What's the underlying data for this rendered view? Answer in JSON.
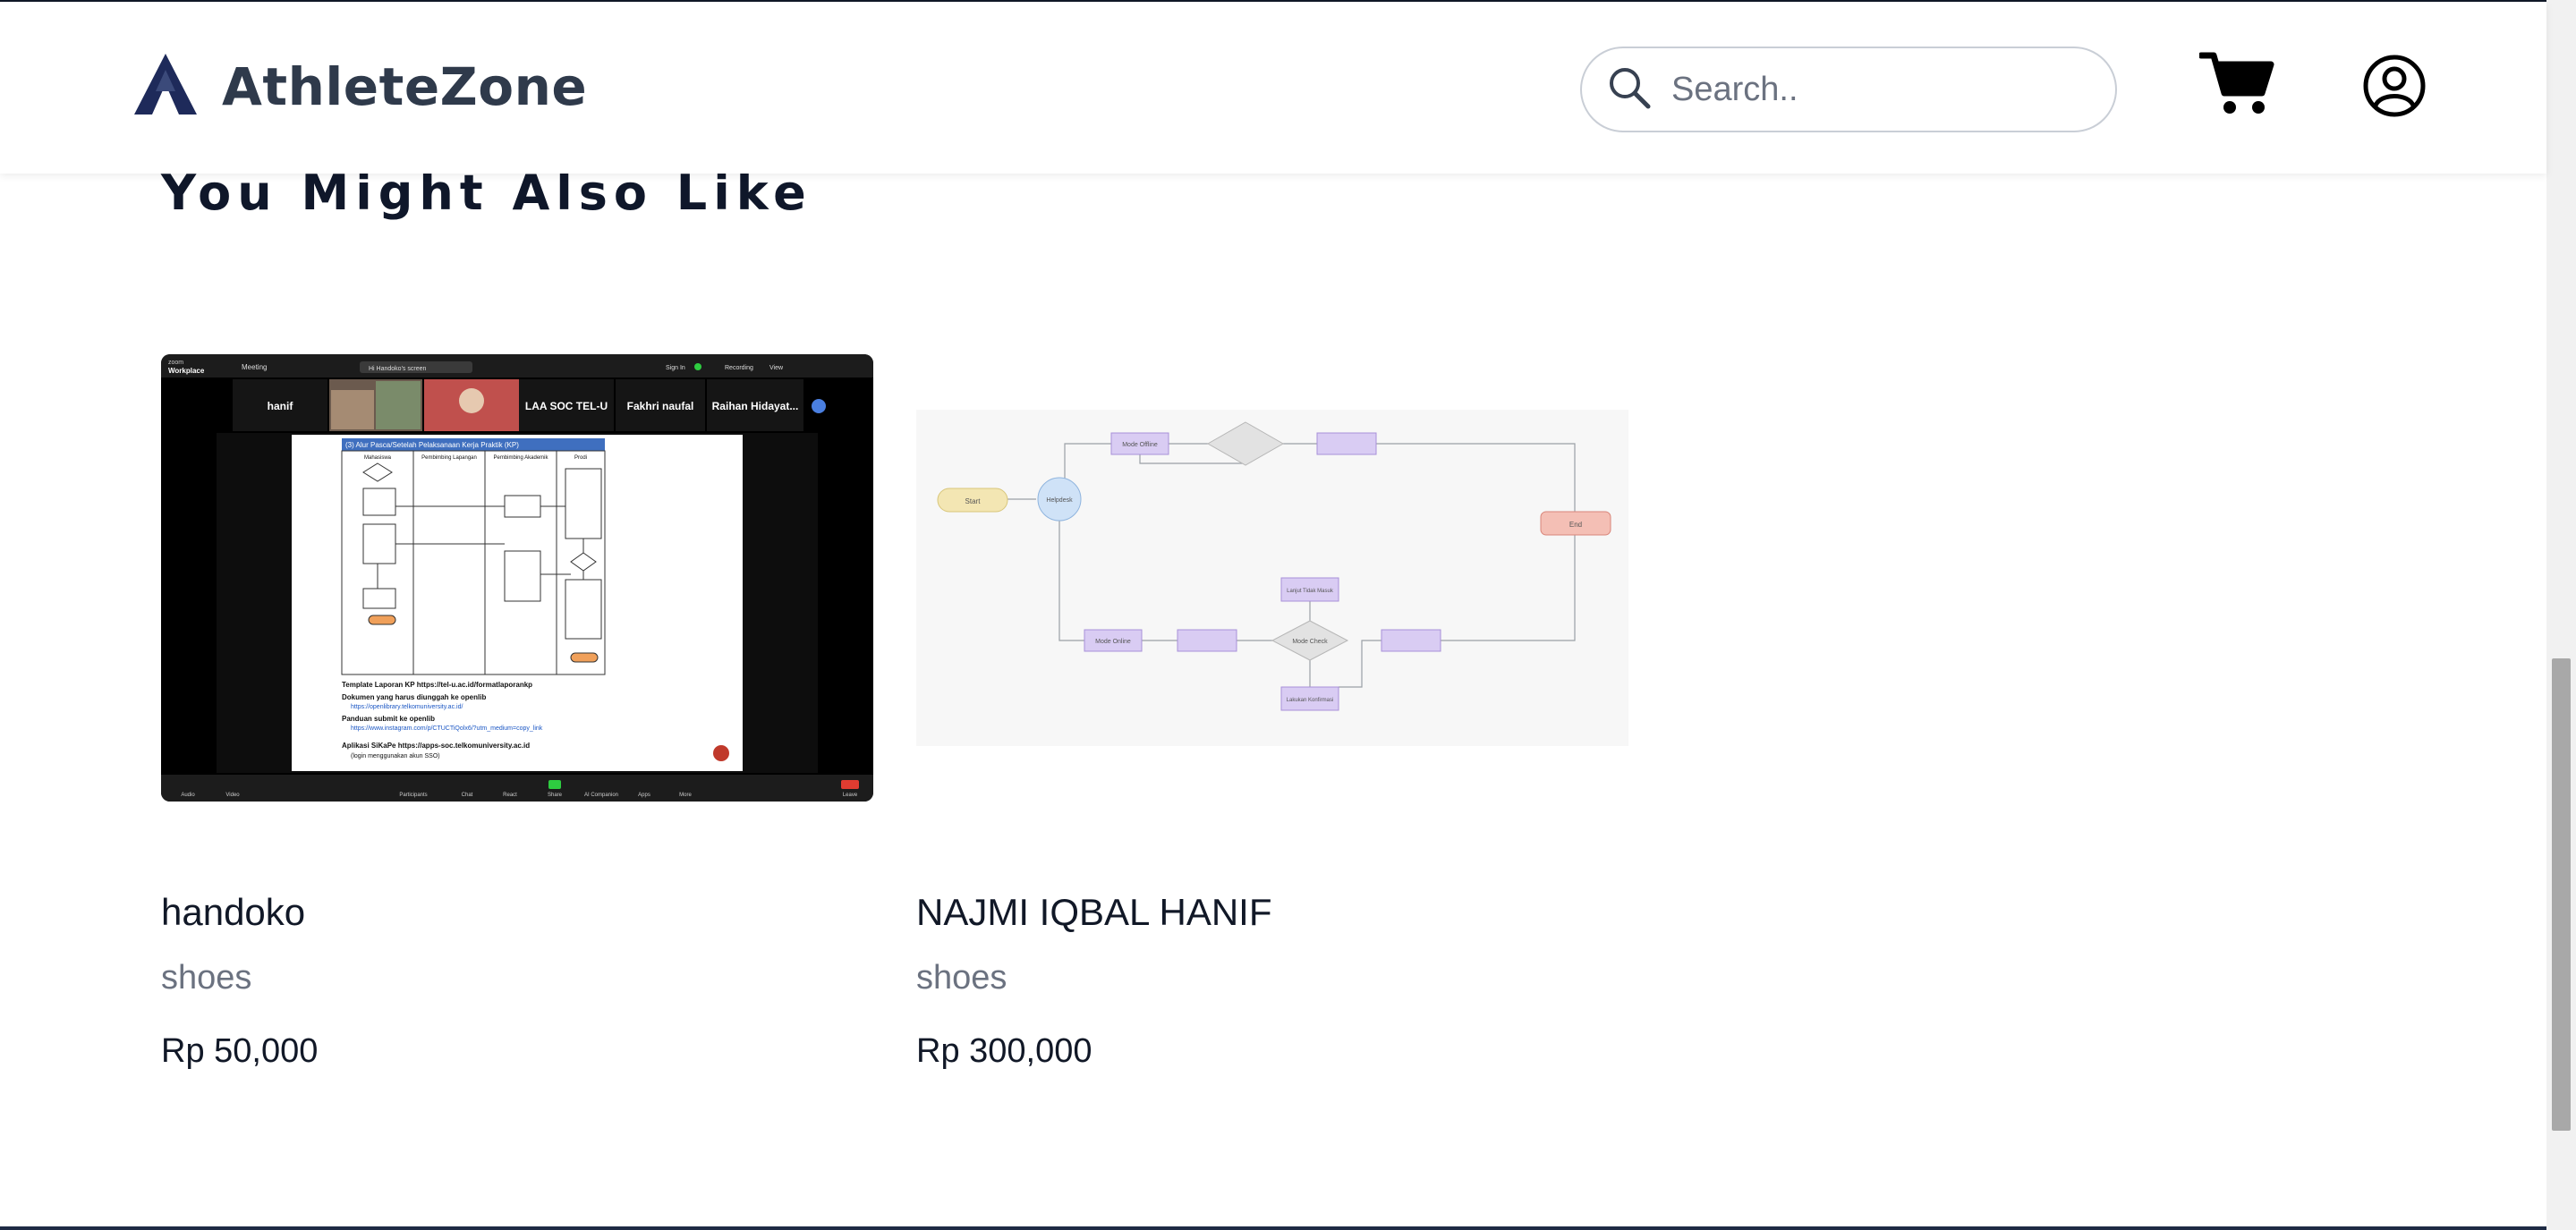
{
  "header": {
    "brand_name": "AthleteZone",
    "search_placeholder": "Search..",
    "icons": {
      "logo": "athletezone-logo",
      "search": "search-icon",
      "cart": "cart-icon",
      "profile": "user-circle-icon"
    }
  },
  "recommendations": {
    "title": "You Might Also Like",
    "products": [
      {
        "name": "handoko",
        "category": "shoes",
        "price": "Rp 50,000",
        "image": "zoom-meeting-screenshot"
      },
      {
        "name": "NAJMI IQBAL HANIF",
        "category": "shoes",
        "price": "Rp 300,000",
        "image": "flowchart-diagram"
      }
    ]
  },
  "thumb1_text": {
    "app": "zoom",
    "app_sub": "Workplace",
    "meeting": "Meeting",
    "screen_share": "Hi Handoko's screen",
    "sign_in": "Sign In",
    "recording": "Recording",
    "view": "View",
    "participants": [
      "hanif",
      "LAA SOC TEL-U",
      "Fakhri naufal",
      "Raihan Hidayat..."
    ],
    "doc_title": "(3) Alur Pasca/Setelah Pelaksanaan Kerja Praktik (KP)",
    "lanes": [
      "Mahasiswa",
      "Pembimbing Lapangan",
      "Pembimbing Akademik",
      "Prodi"
    ],
    "bullets": [
      "Template Laporan KP https://tel-u.ac.id/formatlaporankp",
      "Dokumen yang harus diunggah ke openlib",
      "Panduan submit ke openlib",
      "Aplikasi SiKaPe https://apps-soc.telkomuniversity.ac.id"
    ],
    "toolbar": [
      "Audio",
      "Video",
      "Participants",
      "Chat",
      "React",
      "Share",
      "AI Companion",
      "Apps",
      "More",
      "Leave"
    ]
  },
  "thumb2_text": {
    "nodes": [
      "Start",
      "Helpdesk",
      "Mode Offline",
      "Mode Online",
      "Mode Check",
      "Lanjut Tidak Masuk",
      "Lakukan Konfirmasi",
      "End"
    ]
  },
  "colors": {
    "brand_text": "#2f3a4b",
    "logo": "#1e2a5a",
    "flow_node": "#d9ccf3",
    "flow_start": "#f3e6b3",
    "flow_circle": "#cfe2f7",
    "flow_end": "#f4bfb5"
  }
}
